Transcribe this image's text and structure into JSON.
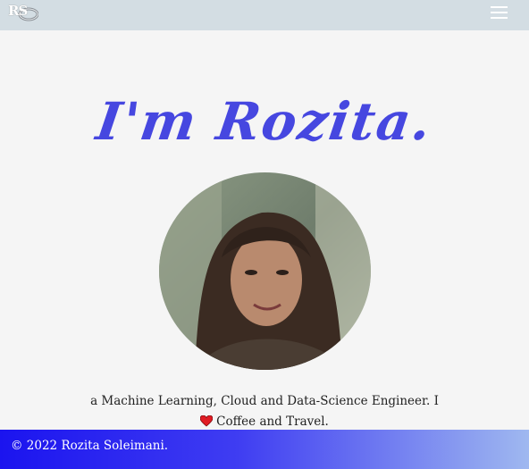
{
  "navbar": {
    "brand": "RS",
    "toggle_icon": "hamburger-menu-icon",
    "background": "#d3dde3"
  },
  "hero": {
    "title": "I'm Rozita.",
    "title_color": "#4647e0"
  },
  "tagline": {
    "line1": "a Machine Learning, Cloud and Data-Science Engineer. I",
    "heart_icon": "heart-icon",
    "line2": "Coffee and Travel."
  },
  "footer": {
    "text": "© 2022 Rozita Soleimani.",
    "gradient_start": "#1b14ef",
    "gradient_end": "#9fb8f0"
  }
}
